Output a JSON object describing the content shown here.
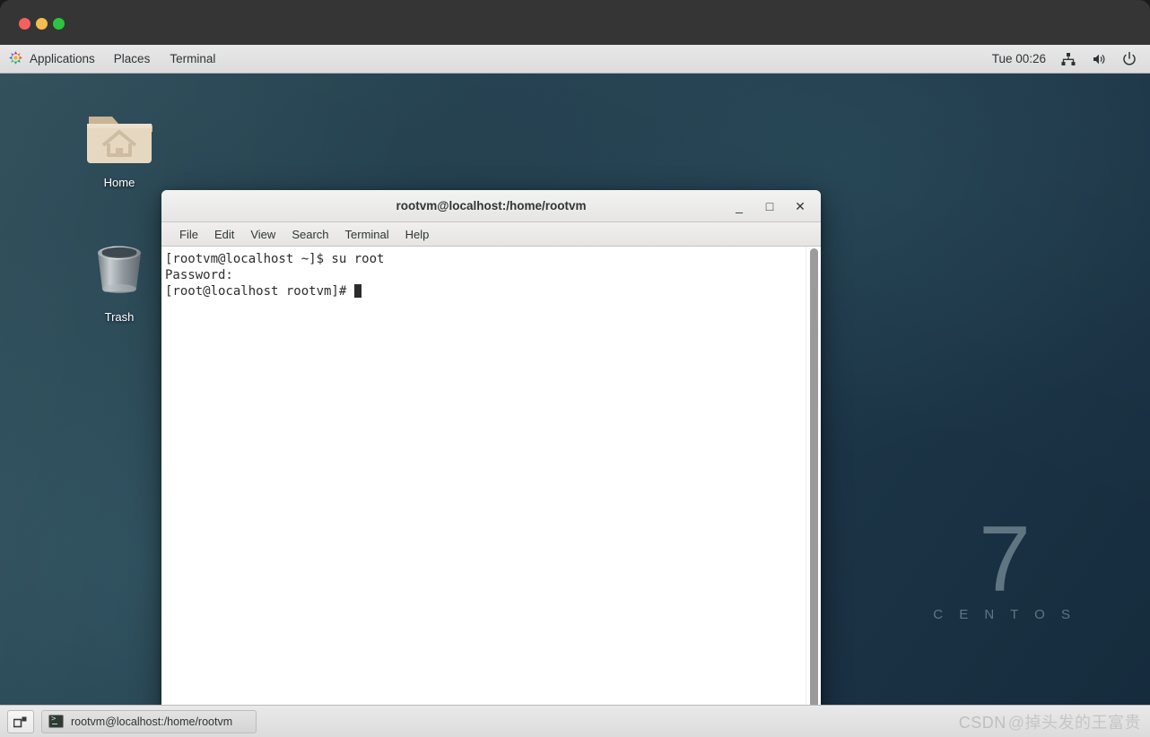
{
  "host_window": {
    "controls": [
      "close",
      "minimize",
      "zoom"
    ]
  },
  "top_panel": {
    "apps_icon": "applications-pinwheel-icon",
    "applications_label": "Applications",
    "places_label": "Places",
    "terminal_label": "Terminal",
    "clock": "Tue 00:26",
    "tray_icons": [
      "network-icon",
      "volume-icon",
      "power-icon"
    ]
  },
  "desktop": {
    "icons": [
      {
        "name": "home",
        "label": "Home",
        "icon": "home-folder-icon"
      },
      {
        "name": "trash",
        "label": "Trash",
        "icon": "trash-can-icon"
      }
    ],
    "wallpaper_mark": {
      "version": "7",
      "product": "C E N T O S"
    }
  },
  "terminal": {
    "title": "rootvm@localhost:/home/rootvm",
    "window_buttons": {
      "minimize": "_",
      "maximize": "□",
      "close": "✕"
    },
    "menu": [
      {
        "name": "file",
        "label": "File"
      },
      {
        "name": "edit",
        "label": "Edit"
      },
      {
        "name": "view",
        "label": "View"
      },
      {
        "name": "search",
        "label": "Search"
      },
      {
        "name": "terminal",
        "label": "Terminal"
      },
      {
        "name": "help",
        "label": "Help"
      }
    ],
    "lines": [
      "[rootvm@localhost ~]$ su root",
      "Password:",
      "[root@localhost rootvm]# "
    ],
    "cursor_visible": true
  },
  "taskbar": {
    "workspace_icon": "workspace-switcher-icon",
    "window_button": {
      "icon": "terminal-icon",
      "label": "rootvm@localhost:/home/rootvm"
    }
  },
  "watermark": {
    "site": "CSDN",
    "author": "@掉头发的王富贵"
  },
  "colors": {
    "desktop_base": "#24404f",
    "panel_bg": "#e4e4e4",
    "terminal_bg": "#ffffff",
    "terminal_fg": "#2b2b2b",
    "traffic_red": "#f4615c",
    "traffic_yellow": "#f5bd4f",
    "traffic_green": "#2dc53f"
  }
}
